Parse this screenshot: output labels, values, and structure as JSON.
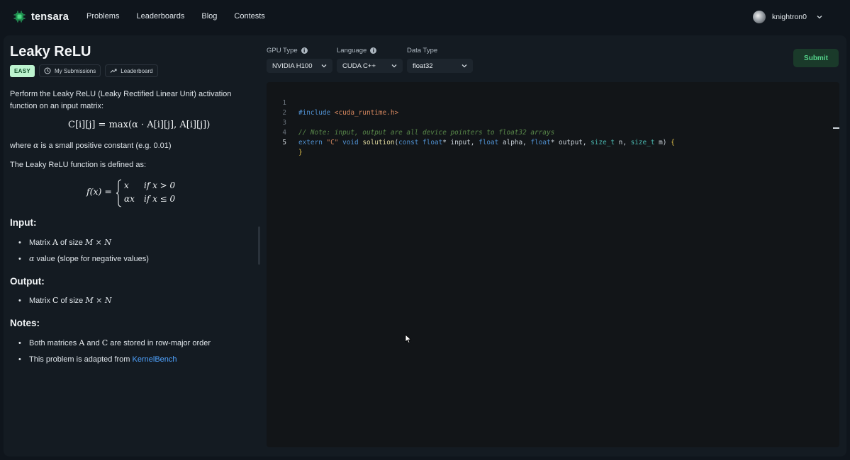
{
  "nav": {
    "brand": "tensara",
    "links": [
      "Problems",
      "Leaderboards",
      "Blog",
      "Contests"
    ],
    "username": "knightron0"
  },
  "problem": {
    "title": "Leaky ReLU",
    "difficulty": "EASY",
    "my_submissions": "My Submissions",
    "leaderboard": "Leaderboard",
    "intro_1": "Perform the Leaky ReLU (Leaky Rectified Linear Unit) activation",
    "intro_2": "function on an input matrix:",
    "formula_main": "C[i][j] = max(α · A[i][j], A[i][j])",
    "where_prefix": "where",
    "where_sym": "α",
    "where_rest": "is a small positive constant (e.g. 0.01)",
    "defined_as": "The Leaky ReLU function is defined as:",
    "piecewise_lhs": "f(x) =",
    "piecewise_1_val": "x",
    "piecewise_1_cond": "if x > 0",
    "piecewise_2_val": "αx",
    "piecewise_2_cond": "if x ≤ 0",
    "input_heading": "Input:",
    "input_items": [
      {
        "pre": "Matrix",
        "sym": "A",
        "mid": "of size",
        "dim": "M × N",
        "post": ""
      },
      {
        "pre": "",
        "sym": "α",
        "mid": "value (slope for negative values)",
        "dim": "",
        "post": ""
      }
    ],
    "output_heading": "Output:",
    "output_items": [
      {
        "pre": "Matrix",
        "sym": "C",
        "mid": "of size",
        "dim": "M × N"
      }
    ],
    "notes_heading": "Notes:",
    "notes": {
      "n1_pre": "Both matrices",
      "n1_a": "A",
      "n1_and": "and",
      "n1_c": "C",
      "n1_post": "are stored in row-major order",
      "n2_pre": "This problem is adapted from",
      "n2_link": "KernelBench"
    }
  },
  "toolbar": {
    "gpu_label": "GPU Type",
    "gpu_value": "NVIDIA H100",
    "lang_label": "Language",
    "lang_value": "CUDA C++",
    "dtype_label": "Data Type",
    "dtype_value": "float32",
    "submit": "Submit"
  },
  "editor": {
    "line_numbers": [
      "1",
      "2",
      "3",
      "4",
      "5"
    ],
    "active_line": "5",
    "line1_kw": "#include",
    "line1_inc": " <cuda_runtime.h>",
    "line3_comment": "// Note: input, output are all device pointers to float32 arrays",
    "line4": {
      "extern": "extern",
      "str": " \"C\"",
      "void": " void",
      "fn": " solution",
      "p1": "(",
      "const": "const",
      "float1": " float",
      "r1": "* input, ",
      "float2": "float",
      "r2": " alpha, ",
      "float3": "float",
      "r3": "* output, ",
      "size1": "size_t",
      "r4": " n, ",
      "size2": "size_t",
      "r5": " m) ",
      "brace": "{"
    },
    "line5": "}"
  },
  "colors": {
    "accent_green": "#54d38a",
    "easy_badge": "#bdf3cf",
    "link": "#4fa3ff",
    "background": "#0f151c"
  }
}
